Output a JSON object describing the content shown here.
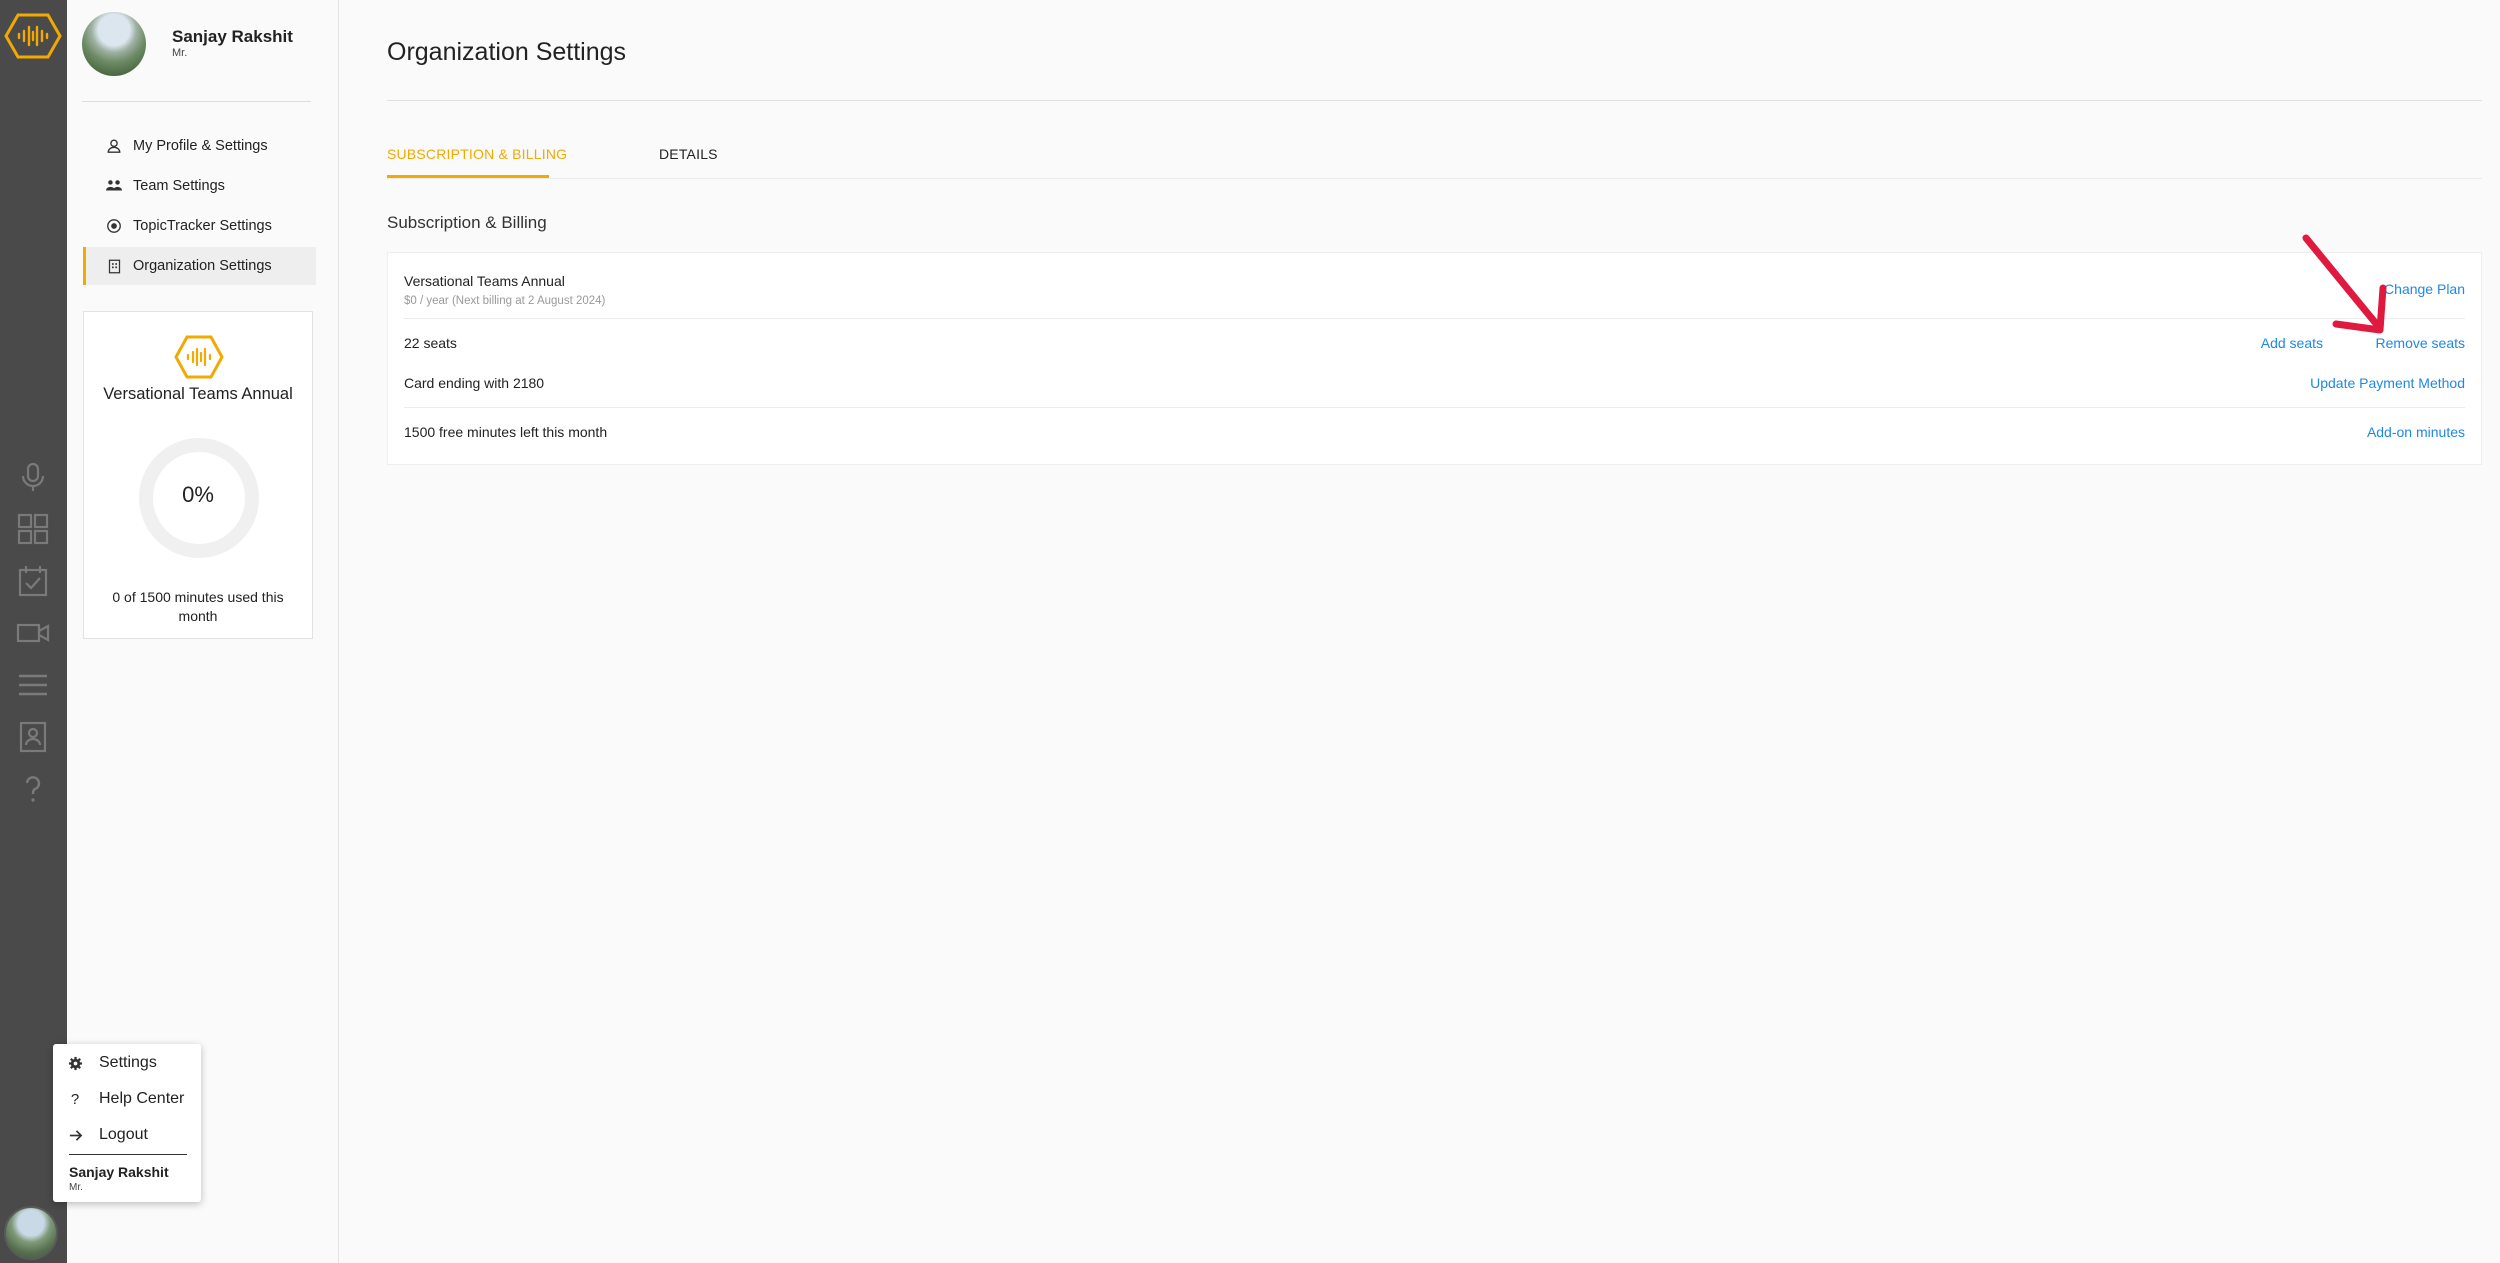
{
  "user": {
    "name": "Sanjay Rakshit",
    "title": "Mr."
  },
  "sidebar": {
    "items": [
      {
        "label": "My Profile & Settings",
        "icon": "person-icon"
      },
      {
        "label": "Team Settings",
        "icon": "team-icon"
      },
      {
        "label": "TopicTracker Settings",
        "icon": "target-icon"
      },
      {
        "label": "Organization Settings",
        "icon": "building-icon",
        "active": true
      }
    ],
    "plan_card": {
      "plan_name": "Versational Teams Annual",
      "percent": "0%",
      "usage": "0 of 1500 minutes used this month",
      "usage_fraction": 0
    }
  },
  "popup_menu": {
    "items": [
      {
        "label": "Settings",
        "icon": "gear-icon"
      },
      {
        "label": "Help Center",
        "icon": "question-icon"
      },
      {
        "label": "Logout",
        "icon": "arrow-right-icon"
      }
    ]
  },
  "main": {
    "title": "Organization Settings",
    "tabs": [
      {
        "label": "SUBSCRIPTION & BILLING",
        "active": true
      },
      {
        "label": "DETAILS",
        "active": false
      }
    ],
    "section_title": "Subscription & Billing",
    "billing": {
      "plan_name": "Versational Teams Annual",
      "plan_detail": "$0 / year (Next billing at 2 August 2024)",
      "change_plan": "Change Plan",
      "seats": "22 seats",
      "add_seats": "Add seats",
      "remove_seats": "Remove seats",
      "card": "Card ending with 2180",
      "update_payment": "Update Payment Method",
      "free_minutes": "1500 free minutes left this month",
      "addon_minutes": "Add-on minutes"
    }
  },
  "colors": {
    "accent": "#f2a900",
    "link": "#1e88e5",
    "rail": "#4a4a4a",
    "annotation": "#e0193f"
  }
}
